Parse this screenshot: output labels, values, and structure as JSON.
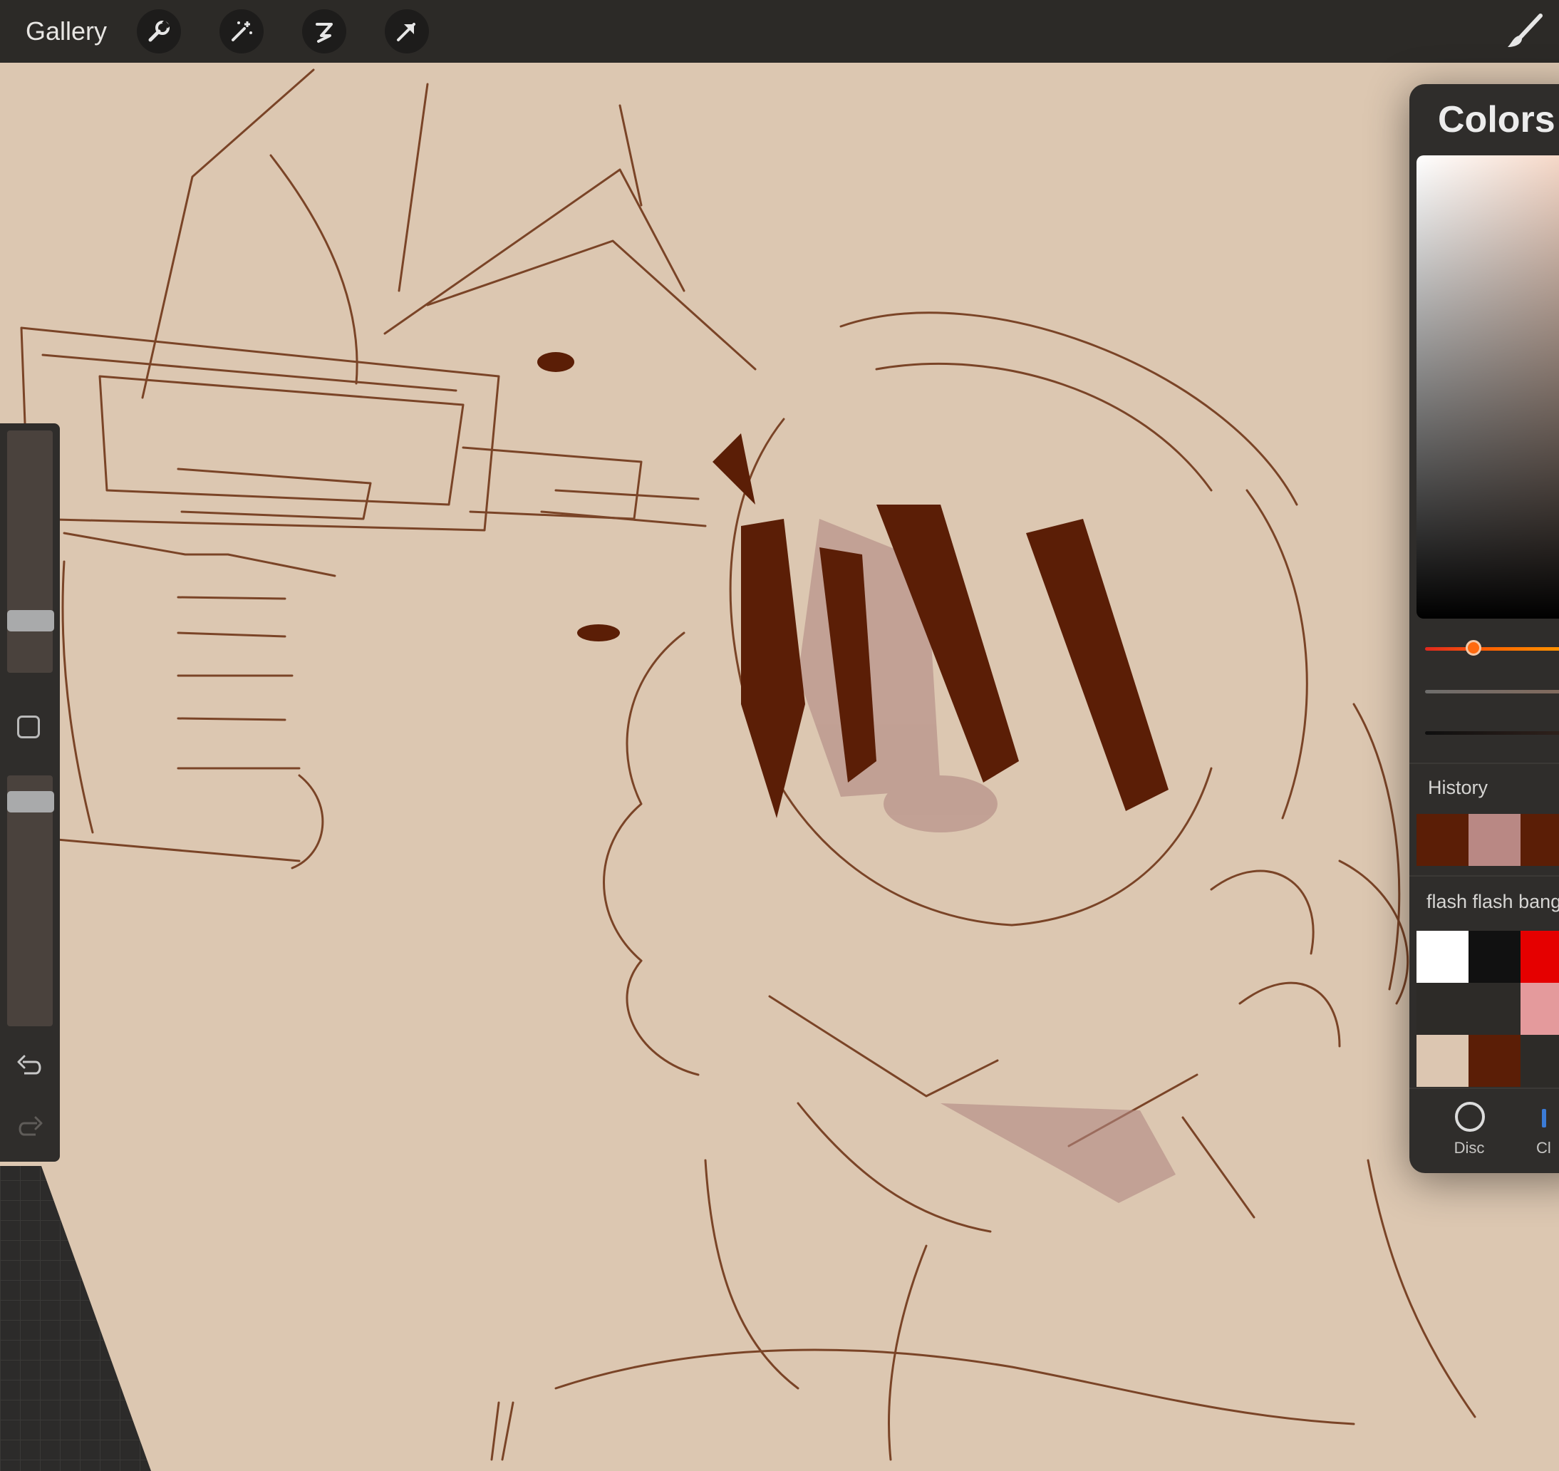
{
  "toolbar": {
    "gallery_label": "Gallery",
    "tools": [
      "wrench-icon",
      "magic-wand-icon",
      "selection-icon",
      "transform-arrow-icon"
    ],
    "right_tool": "brush-icon"
  },
  "sidebar": {
    "brush_size_level": 0.78,
    "opacity_level": 0.96,
    "icons": [
      "modify-square-icon",
      "undo-icon",
      "redo-icon"
    ]
  },
  "colors_panel": {
    "title": "Colors",
    "hue_level": 0.26,
    "history_label": "History",
    "history": [
      "#5b1e06",
      "#b98884",
      "#5b1e06"
    ],
    "palette_label": "flash flash bang",
    "palette": [
      [
        "#ffffff",
        "#111111",
        "#e50000"
      ],
      [
        "#2d2b28",
        "#2d2b28",
        "#e49a9c"
      ],
      [
        "#dcc6b1",
        "#5b1e06",
        "#2d2b28"
      ]
    ],
    "tabs": [
      "Disc",
      "Cl"
    ]
  },
  "colors": {
    "canvas_bg": "#dcc7b1",
    "sketch_stroke": "#6e3a1e",
    "dark_ink": "#5b1e06",
    "mauve": "#b08782"
  }
}
